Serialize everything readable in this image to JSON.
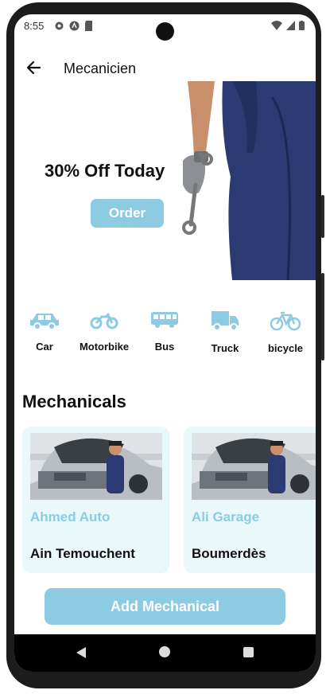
{
  "status": {
    "time": "8:55"
  },
  "appbar": {
    "title": "Mecanicien"
  },
  "banner": {
    "promo": "30% Off Today",
    "order_label": "Order"
  },
  "categories": [
    {
      "label": "Car",
      "icon": "car-icon"
    },
    {
      "label": "Motorbike",
      "icon": "motorbike-icon"
    },
    {
      "label": "Bus",
      "icon": "bus-icon"
    },
    {
      "label": "Truck",
      "icon": "truck-icon"
    },
    {
      "label": "bicycle",
      "icon": "bicycle-icon"
    }
  ],
  "section": {
    "title": "Mechanicals"
  },
  "mechanicals": [
    {
      "name": "Ahmed Auto",
      "city": "Ain Temouchent"
    },
    {
      "name": "Ali Garage",
      "city": "Boumerdès"
    }
  ],
  "footer": {
    "add_label": "Add Mechanical"
  },
  "colors": {
    "accent": "#8ccbe1",
    "card_bg": "#e9f8fb",
    "workwear": "#2b3a73"
  }
}
